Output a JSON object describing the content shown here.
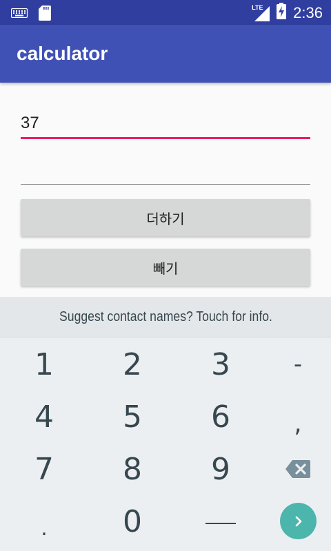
{
  "status_bar": {
    "time": "2:36",
    "network": "LTE",
    "icons": [
      "keyboard-icon",
      "sd-card-icon",
      "signal-icon",
      "battery-charging-icon"
    ]
  },
  "app_bar": {
    "title": "calculator"
  },
  "form": {
    "input1_value": "37",
    "input2_value": "",
    "add_label": "더하기",
    "subtract_label": "빼기"
  },
  "keyboard": {
    "suggestion": "Suggest contact names? Touch for info.",
    "keys": {
      "k1": "1",
      "k2": "2",
      "k3": "3",
      "minus": "-",
      "k4": "4",
      "k5": "5",
      "k6": "6",
      "comma": ",",
      "k7": "7",
      "k8": "8",
      "k9": "9",
      "dot": ".",
      "k0": "0"
    },
    "action_icons": [
      "backspace-icon",
      "space-icon",
      "go-icon"
    ],
    "go_color": "#4db6ac"
  },
  "colors": {
    "status_bar": "#303f9f",
    "app_bar": "#3f51b5",
    "accent": "#e91e63"
  }
}
